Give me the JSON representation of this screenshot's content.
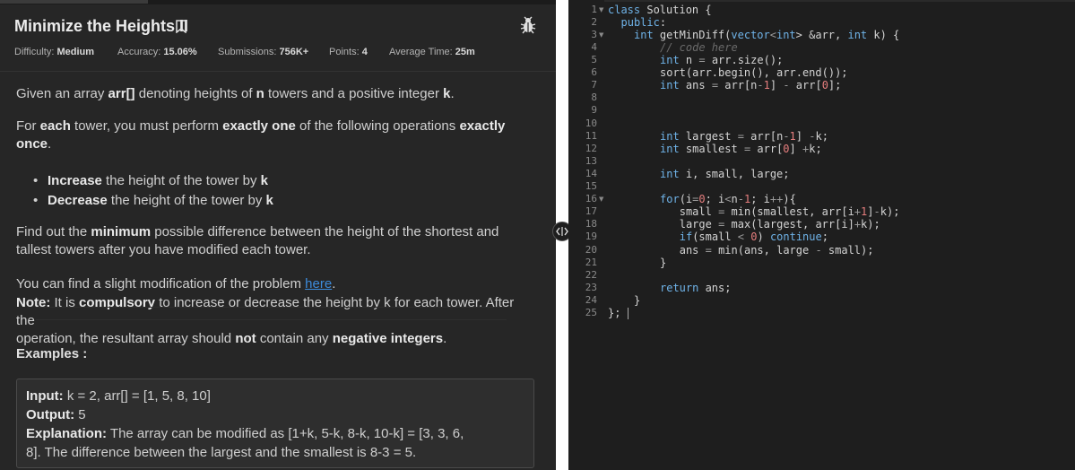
{
  "problem": {
    "title": "Minimize the Heights II",
    "meta": {
      "difficulty_label": "Difficulty:",
      "difficulty_value": "Medium",
      "accuracy_label": "Accuracy:",
      "accuracy_value": "15.06%",
      "submissions_label": "Submissions:",
      "submissions_value": "756K+",
      "points_label": "Points:",
      "points_value": "4",
      "avg_time_label": "Average Time:",
      "avg_time_value": "25m"
    },
    "p1": {
      "t1": "Given an array ",
      "b1": "arr[]",
      "t2": " denoting heights of ",
      "b2": "n",
      "t3": " towers and a positive integer ",
      "b3": "k",
      "t4": "."
    },
    "p2": {
      "t1": "For ",
      "b1": "each",
      "t2": " tower, you must perform ",
      "b2": "exactly one",
      "t3": " of the following operations ",
      "b3": "exactly",
      "line2_b": "once",
      "line2_t": "."
    },
    "ops": [
      {
        "bold": "Increase",
        "text": " the height of the tower by ",
        "k": "k"
      },
      {
        "bold": "Decrease",
        "text": " the height of the tower by ",
        "k": "k"
      }
    ],
    "p3": {
      "t1": "Find out the ",
      "b1": "minimum",
      "t2": " possible difference between the height of the shortest and",
      "line2": "tallest towers after you have modified each tower."
    },
    "p4": {
      "t1": "You can find a slight modification of the problem ",
      "link": "here",
      "t2": "."
    },
    "note": {
      "label": "Note:",
      "t1": " It is ",
      "b1": "compulsory",
      "t2": " to increase or decrease the height by k for each tower. After the",
      "line2_t1": "operation, the resultant array should ",
      "line2_b1": "not",
      "line2_t2": " contain any ",
      "line2_b2": "negative integers",
      "line2_t3": "."
    },
    "examples_heading": "Examples :",
    "example": {
      "input_label": "Input:",
      "input_value": " k  =  2, arr[]  =  [1, 5, 8, 10]",
      "output_label": "Output:",
      "output_value": " 5",
      "explanation_label": "Explanation:",
      "explanation_line1": " The array can be modified as [1+k, 5-k, 8-k, 10-k]  =  [3, 3, 6,",
      "explanation_line2": "8]. The difference between the largest and the smallest is 8-3  =  5."
    }
  },
  "editor": {
    "line_numbers": [
      "1",
      "2",
      "3",
      "4",
      "5",
      "6",
      "7",
      "8",
      "9",
      "10",
      "11",
      "12",
      "13",
      "14",
      "15",
      "16",
      "17",
      "18",
      "19",
      "20",
      "21",
      "22",
      "23",
      "24",
      "25"
    ],
    "code": {
      "l1": [
        "class",
        " Solution {"
      ],
      "l2": [
        "public",
        ":"
      ],
      "l3": [
        "int",
        " getMinDiff(",
        "vector",
        "<",
        "int",
        "> &arr, ",
        "int",
        " k) {"
      ],
      "l4": "// code here",
      "l5": [
        "int",
        " n ",
        "=",
        " arr.size();"
      ],
      "l6": "sort(arr.begin(), arr.end());",
      "l7": [
        "int",
        " ans ",
        "=",
        " arr[n",
        "-",
        "1",
        "] ",
        "-",
        " arr[",
        "0",
        "];"
      ],
      "l11": [
        "int",
        " largest ",
        "=",
        " arr[n",
        "-",
        "1",
        "] ",
        "-",
        "k;"
      ],
      "l12": [
        "int",
        " smallest ",
        "=",
        " arr[",
        "0",
        "] ",
        "+",
        "k;"
      ],
      "l14": [
        "int",
        " i, small, large;"
      ],
      "l16": [
        "for",
        "(i",
        "=",
        "0",
        "; i",
        "<",
        "n",
        "-",
        "1",
        "; i",
        "++",
        "){"
      ],
      "l17": [
        " small ",
        "=",
        " min(smallest, arr[i",
        "+",
        "1",
        "]",
        "-",
        "k);"
      ],
      "l18": [
        " large ",
        "=",
        " max(largest, arr[i]",
        "+",
        "k);"
      ],
      "l19": [
        "if",
        "(small ",
        "<",
        " ",
        "0",
        ") ",
        "continue",
        ";"
      ],
      "l20": [
        " ans ",
        "=",
        " min(ans, large ",
        "-",
        " small);"
      ],
      "l21": "}",
      "l23": [
        "return",
        " ans;"
      ],
      "l24": "}",
      "l25": "};"
    }
  },
  "colors": {
    "panel_bg": "#262626",
    "editor_bg": "#1e1e1e",
    "keyword": "#6fb3e8",
    "number": "#e67e7e",
    "link": "#3d8bdb"
  }
}
